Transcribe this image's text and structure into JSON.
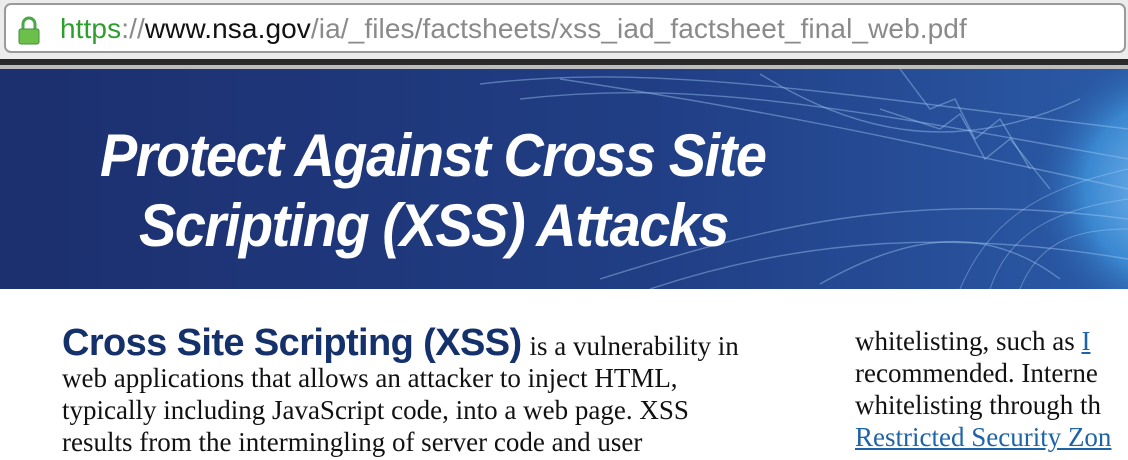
{
  "browser": {
    "url_scheme": "https",
    "url_separator": "://",
    "url_host": "www.nsa.gov",
    "url_path": "/ia/_files/factsheets/xss_iad_factsheet_final_web.pdf",
    "lock_icon": "lock-icon"
  },
  "pdf": {
    "banner": {
      "title_line1": "Protect Against Cross Site",
      "title_line2": "Scripting (XSS) Attacks"
    },
    "left_column": {
      "heading": "Cross Site Scripting (XSS)",
      "lines": [
        "is a vulnerability in",
        "web applications that allows an attacker to inject HTML,",
        "typically including JavaScript code, into a web page. XSS",
        "results from the intermingling of server code and user"
      ]
    },
    "right_column": {
      "lines": [
        "whitelisting, such as",
        "recommended. Interne",
        "whitelisting through th"
      ],
      "link_fragment_top": "I",
      "link_text": "Restricted Security Zon"
    }
  },
  "colors": {
    "banner": "#1e3a78",
    "heading": "#15316b",
    "https_green": "#2e9e2e",
    "link": "#1d63a8"
  }
}
